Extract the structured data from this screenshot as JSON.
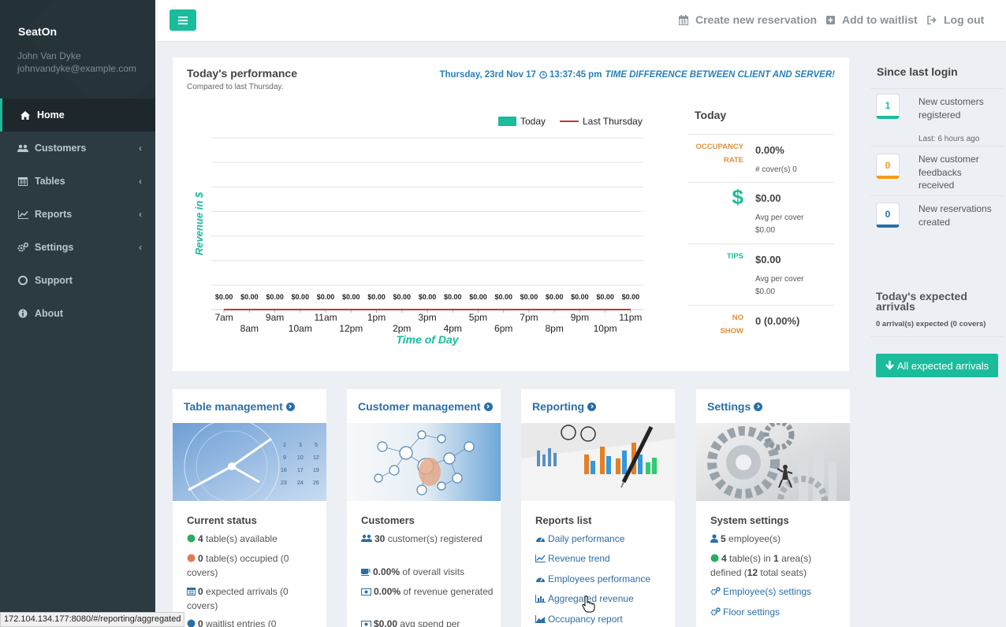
{
  "sidebar": {
    "brand": "SeatOn",
    "user_name": "John Van Dyke",
    "user_email": "johnvandyke@example.com",
    "items": [
      {
        "label": "Home",
        "icon": "home-icon",
        "active": true
      },
      {
        "label": "Customers",
        "icon": "users-icon",
        "chevron": true
      },
      {
        "label": "Tables",
        "icon": "calendar-icon",
        "chevron": true
      },
      {
        "label": "Reports",
        "icon": "line-chart-icon",
        "chevron": true
      },
      {
        "label": "Settings",
        "icon": "cogs-icon",
        "chevron": true
      },
      {
        "label": "Support",
        "icon": "lifebuoy-icon"
      },
      {
        "label": "About",
        "icon": "info-icon"
      }
    ]
  },
  "topbar": {
    "create_label": "Create new reservation",
    "waitlist_label": "Add to waitlist",
    "logout_label": "Log out"
  },
  "performance": {
    "title": "Today's performance",
    "subtitle": "Compared to last Thursday.",
    "date": "Thursday, 23rd Nov 17",
    "time": "13:37:45 pm",
    "warning": "TIME DIFFERENCE BETWEEN CLIENT AND SERVER!",
    "today_heading": "Today",
    "occupancy_label_1": "OCCUPANCY",
    "occupancy_label_2": "RATE",
    "occupancy_value": "0.00%",
    "occupancy_sub": "# cover(s) 0",
    "revenue_symbol": "$",
    "revenue_value": "$0.00",
    "revenue_sub_1": "Avg per cover",
    "revenue_sub_2": "$0.00",
    "tips_label": "TIPS",
    "tips_value": "$0.00",
    "tips_sub_1": "Avg per cover",
    "tips_sub_2": "$0.00",
    "noshow_label_1": "NO",
    "noshow_label_2": "SHOW",
    "noshow_value": "0 (0.00%)"
  },
  "chart_data": {
    "type": "bar",
    "xlabel": "Time of Day",
    "ylabel": "Revenue in $",
    "categories": [
      "7am",
      "8am",
      "9am",
      "10am",
      "11am",
      "12pm",
      "1pm",
      "2pm",
      "3pm",
      "4pm",
      "5pm",
      "6pm",
      "7pm",
      "8pm",
      "9pm",
      "10pm",
      "11pm"
    ],
    "series": [
      {
        "name": "Today",
        "type": "bar",
        "values": [
          0,
          0,
          0,
          0,
          0,
          0,
          0,
          0,
          0,
          0,
          0,
          0,
          0,
          0,
          0,
          0,
          0
        ]
      },
      {
        "name": "Last Thursday",
        "type": "line",
        "values": [
          0,
          0,
          0,
          0,
          0,
          0,
          0,
          0,
          0,
          0,
          0,
          0,
          0,
          0,
          0,
          0,
          0
        ]
      }
    ],
    "data_labels": [
      "$0.00",
      "$0.00",
      "$0.00",
      "$0.00",
      "$0.00",
      "$0.00",
      "$0.00",
      "$0.00",
      "$0.00",
      "$0.00",
      "$0.00",
      "$0.00",
      "$0.00",
      "$0.00",
      "$0.00",
      "$0.00",
      "$0.00"
    ],
    "legend": "top-right",
    "grid": true,
    "colors": {
      "today": "#1abc9c",
      "last": "#c0392b"
    }
  },
  "since_last_login": {
    "heading": "Since last login",
    "items": [
      {
        "count": "1",
        "text": "New customers registered",
        "note": "Last: 6 hours ago",
        "color": "#1abc9c"
      },
      {
        "count": "0",
        "text": "New customer feedbacks received",
        "color": "#f39c12"
      },
      {
        "count": "0",
        "text": "New reservations created",
        "color": "#2a6fa8"
      }
    ],
    "arrivals_heading": "Today's expected arrivals",
    "arrivals_sub": "0 arrival(s) expected (0 covers)",
    "arrivals_button": "All expected arrivals"
  },
  "cards": {
    "table": {
      "title": "Table management",
      "sub": "Current status",
      "l1_num": "4",
      "l1_txt": " table(s) available",
      "l2_num": "0",
      "l2_txt": " table(s) occupied (0 covers)",
      "l3_num": "0",
      "l3_txt": " expected arrivals (0 covers)",
      "l4_num": "0",
      "l4_txt": " waitlist entries (0"
    },
    "customer": {
      "title": "Customer management",
      "sub": "Customers",
      "l1_num": "30",
      "l1_txt": " customer(s) registered",
      "l2_num": "0.00%",
      "l2_txt": " of overall visits",
      "l3_num": "0.00%",
      "l3_txt": " of revenue generated",
      "l4_num": "$0.00",
      "l4_txt": " avg spend per"
    },
    "reporting": {
      "title": "Reporting",
      "sub": "Reports list",
      "links": [
        "Daily performance",
        "Revenue trend",
        "Employees performance",
        "Aggregated revenue",
        "Occupancy report"
      ]
    },
    "settings": {
      "title": "Settings",
      "sub": "System settings",
      "l1_num": "5",
      "l1_txt": " employee(s)",
      "l2_num": "4",
      "l2_mid": " table(s) in ",
      "l2_num2": "1",
      "l2_mid2": " area(s) defined (",
      "l2_num3": "12",
      "l2_end": " total seats)",
      "link1": "Employee(s) settings",
      "link2": "Floor settings"
    }
  },
  "status_url": "172.104.134.177:8080/#/reporting/aggregated"
}
